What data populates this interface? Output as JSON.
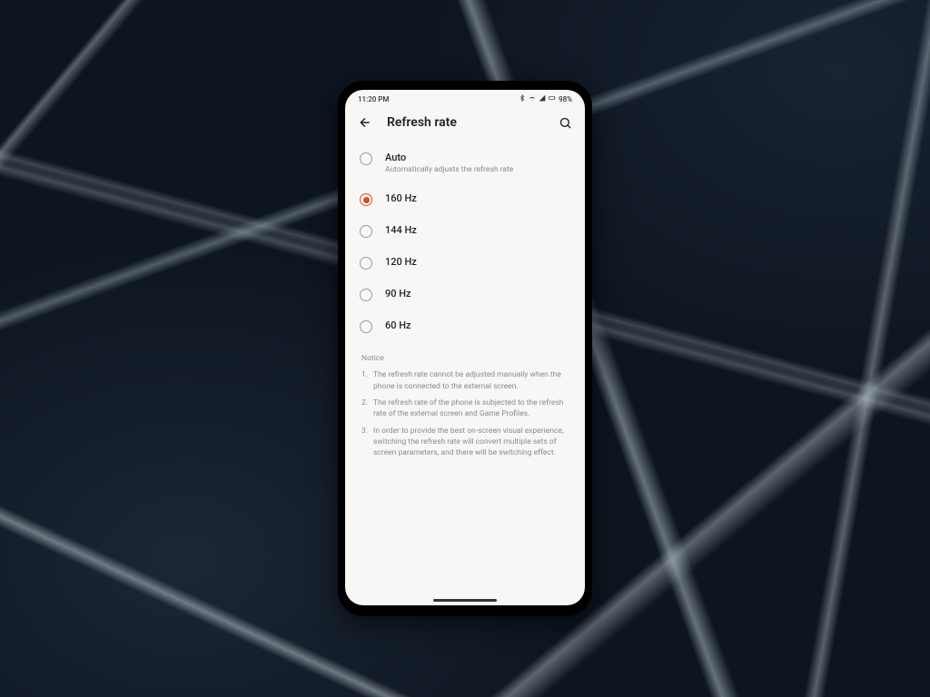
{
  "statusbar": {
    "time": "11:20 PM",
    "battery": "98%"
  },
  "header": {
    "title": "Refresh rate"
  },
  "options": [
    {
      "label": "Auto",
      "sub": "Automatically adjusts the refresh rate",
      "selected": false
    },
    {
      "label": "160 Hz",
      "sub": "",
      "selected": true
    },
    {
      "label": "144 Hz",
      "sub": "",
      "selected": false
    },
    {
      "label": "120 Hz",
      "sub": "",
      "selected": false
    },
    {
      "label": "90 Hz",
      "sub": "",
      "selected": false
    },
    {
      "label": "60 Hz",
      "sub": "",
      "selected": false
    }
  ],
  "notice": {
    "heading": "Notice",
    "items": [
      "The refresh rate cannot be adjusted manually when the phone is connected to the external screen.",
      "The refresh rate of the phone is subjected to the refresh rate of the external screen and Game Profiles.",
      "In order to provide the best on-screen visual experience, switching the refresh rate will convert multiple sets of screen parameters, and there will be switching effect."
    ]
  }
}
